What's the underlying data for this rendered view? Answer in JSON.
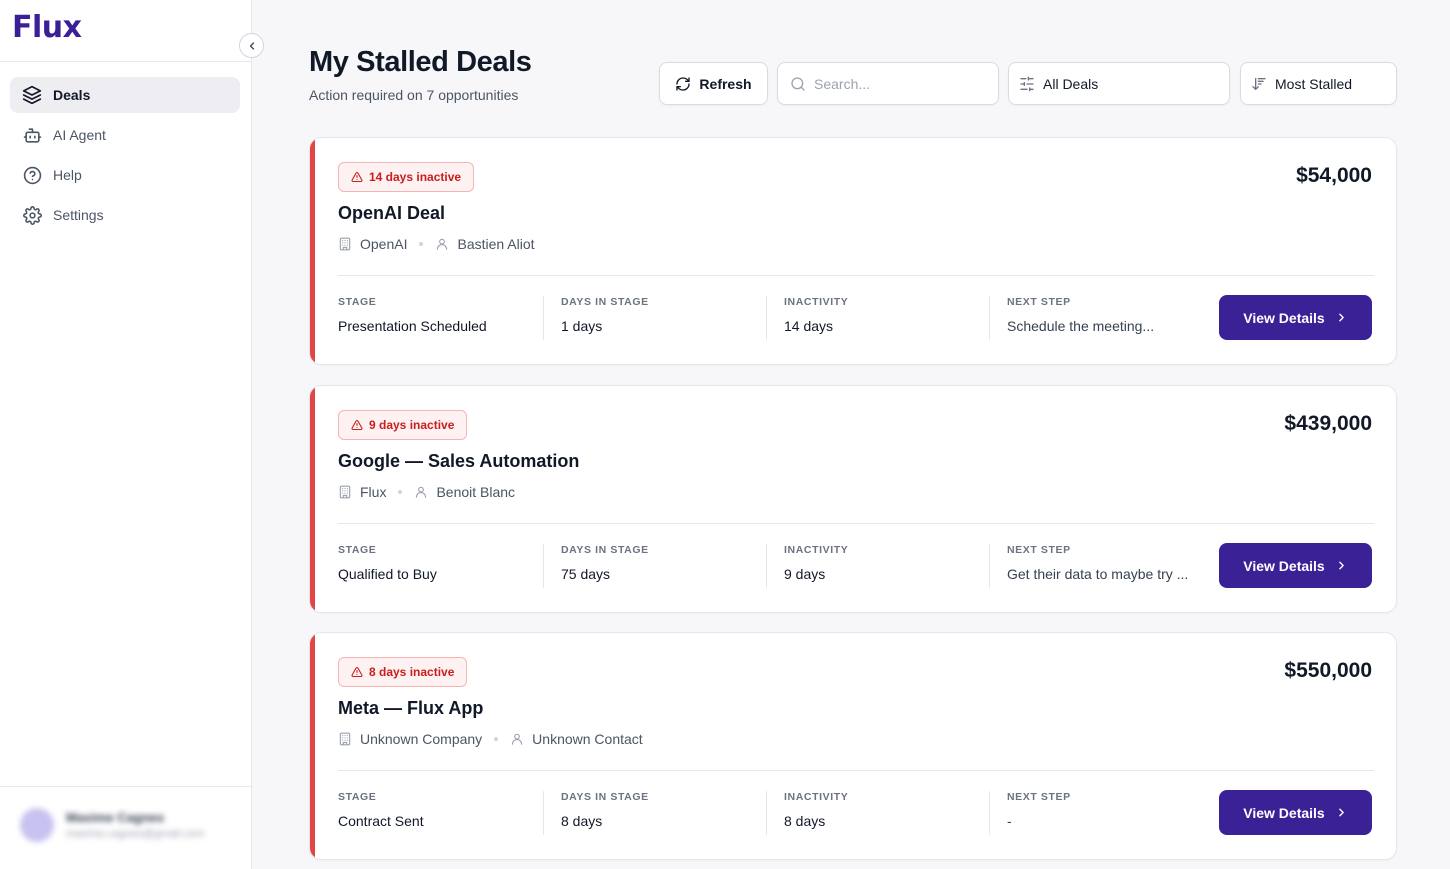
{
  "app": {
    "logo": "Flux"
  },
  "sidebar": {
    "items": [
      {
        "label": "Deals",
        "icon": "layers-icon",
        "active": true
      },
      {
        "label": "AI Agent",
        "icon": "bot-icon",
        "active": false
      },
      {
        "label": "Help",
        "icon": "help-circle-icon",
        "active": false
      },
      {
        "label": "Settings",
        "icon": "gear-icon",
        "active": false
      }
    ],
    "user": {
      "name": "Maxime Cagnes",
      "email": "maxime.cagnes@gmail.com"
    }
  },
  "header": {
    "title": "My Stalled Deals",
    "subtitle": "Action required on 7 opportunities",
    "refresh_label": "Refresh",
    "search_placeholder": "Search...",
    "filter_value": "All Deals",
    "sort_value": "Most Stalled"
  },
  "labels": {
    "stage": "STAGE",
    "days_in_stage": "DAYS IN STAGE",
    "inactivity": "INACTIVITY",
    "next_step": "NEXT STEP",
    "view_details": "View Details"
  },
  "deals": [
    {
      "badge": "14 days inactive",
      "title": "OpenAI Deal",
      "amount": "$54,000",
      "company": "OpenAI",
      "contact": "Bastien Aliot",
      "stage": "Presentation Scheduled",
      "days_in_stage": "1 days",
      "inactivity": "14 days",
      "next_step": "Schedule the meeting..."
    },
    {
      "badge": "9 days inactive",
      "title": "Google — Sales Automation",
      "amount": "$439,000",
      "company": "Flux",
      "contact": "Benoit Blanc",
      "stage": "Qualified to Buy",
      "days_in_stage": "75 days",
      "inactivity": "9 days",
      "next_step": "Get their data to maybe try ..."
    },
    {
      "badge": "8 days inactive",
      "title": "Meta — Flux App",
      "amount": "$550,000",
      "company": "Unknown Company",
      "contact": "Unknown Contact",
      "stage": "Contract Sent",
      "days_in_stage": "8 days",
      "inactivity": "8 days",
      "next_step": "-"
    }
  ],
  "colors": {
    "brand": "#3b2196",
    "alert": "#e04646",
    "badge_text": "#c81e1e"
  }
}
